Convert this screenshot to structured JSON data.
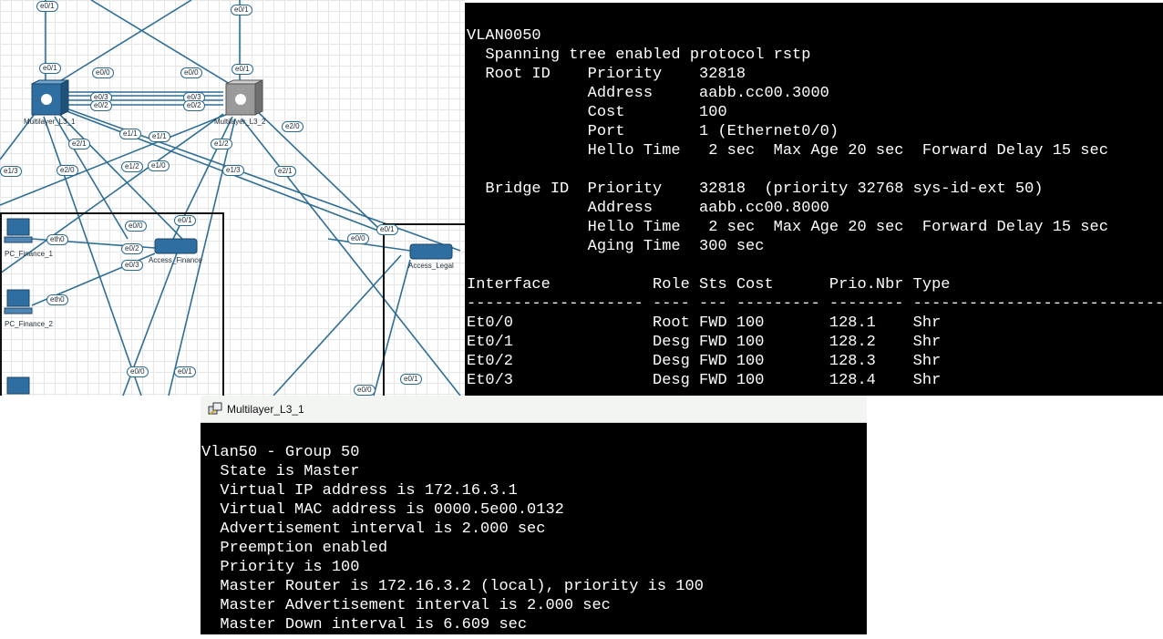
{
  "topology": {
    "devices": {
      "l3_1": "Multilayer_L3_1",
      "l3_2": "Multilayer_L3_2",
      "access_finance": "Access_Finance",
      "access_legal": "Access_Legal",
      "pc1": "PC_Finance_1",
      "pc2": "PC_Finance_2"
    },
    "ports": {
      "p1": "e0/1",
      "p2": "e0/1",
      "p3": "e0/1",
      "p4": "e0/1",
      "p5": "e0/0",
      "p6": "e0/0",
      "p7": "e0/3",
      "p8": "e0/2",
      "p9": "e0/3",
      "p10": "e0/2",
      "p11": "e2/0",
      "p12": "e1/1",
      "p13": "e1/1",
      "p14": "e2/1",
      "p15": "e1/2",
      "p16": "e1/0",
      "p17": "e1/2",
      "p18": "e1/3",
      "p19": "e2/0",
      "p20": "e2/1",
      "p21": "e1/3",
      "p22": "e0/0",
      "p23": "e0/1",
      "p24": "eth0",
      "p25": "e0/2",
      "p26": "e0/3",
      "p27": "eth0",
      "p28": "e0/1",
      "p29": "e0/0",
      "p30": "e0/0",
      "p31": "e0/1",
      "p32": "e0/0",
      "p33": "e0/1"
    }
  },
  "terminal_top": {
    "lines": [
      "VLAN0050",
      "  Spanning tree enabled protocol rstp",
      "  Root ID    Priority    32818",
      "             Address     aabb.cc00.3000",
      "             Cost        100",
      "             Port        1 (Ethernet0/0)",
      "             Hello Time   2 sec  Max Age 20 sec  Forward Delay 15 sec",
      "",
      "  Bridge ID  Priority    32818  (priority 32768 sys-id-ext 50)",
      "             Address     aabb.cc00.8000",
      "             Hello Time   2 sec  Max Age 20 sec  Forward Delay 15 sec",
      "             Aging Time  300 sec",
      "",
      "Interface           Role Sts Cost      Prio.Nbr Type",
      "------------------- ---- --- --------- -------- --------------------------------",
      "Et0/0               Root FWD 100       128.1    Shr",
      "Et0/1               Desg FWD 100       128.2    Shr",
      "Et0/2               Desg FWD 100       128.3    Shr",
      "Et0/3               Desg FWD 100       128.4    Shr"
    ]
  },
  "terminal_bottom": {
    "title": "Multilayer_L3_1",
    "lines": [
      "Vlan50 - Group 50",
      "  State is Master",
      "  Virtual IP address is 172.16.3.1",
      "  Virtual MAC address is 0000.5e00.0132",
      "  Advertisement interval is 2.000 sec",
      "  Preemption enabled",
      "  Priority is 100",
      "  Master Router is 172.16.3.2 (local), priority is 100",
      "  Master Advertisement interval is 2.000 sec",
      "  Master Down interval is 6.609 sec"
    ]
  },
  "colors": {
    "link": "#2f6e94",
    "terminal_bg": "#000000",
    "terminal_fg": "#ffffff"
  }
}
